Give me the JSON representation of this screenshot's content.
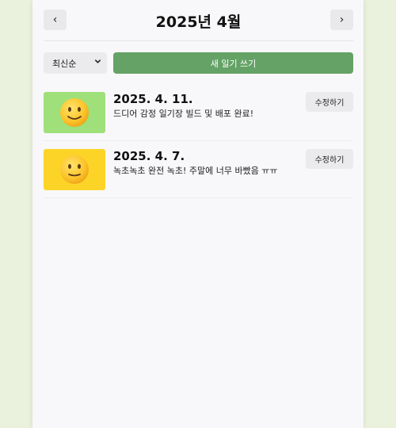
{
  "header": {
    "prev_label": "‹",
    "title": "2025년 4월",
    "next_label": "›"
  },
  "controls": {
    "sort_selected": "최신순",
    "new_button_label": "새 일기 쓰기"
  },
  "entries": [
    {
      "date": "2025. 4. 11.",
      "content": "드디어 감정 일기장 빌드 및 배포 완료!",
      "emotion_color": "#9fe07a",
      "emotion_icon": "slightly-smiling-face-icon",
      "edit_label": "수정하기"
    },
    {
      "date": "2025. 4. 7.",
      "content": "녹초녹초 완전 녹초! 주말에 너무 바빴음 ㅠㅠ",
      "emotion_color": "#fcd428",
      "emotion_icon": "neutral-smiling-face-icon",
      "edit_label": "수정하기"
    }
  ],
  "colors": {
    "accent_green": "#64a266",
    "page_background": "#eaf1dd"
  }
}
